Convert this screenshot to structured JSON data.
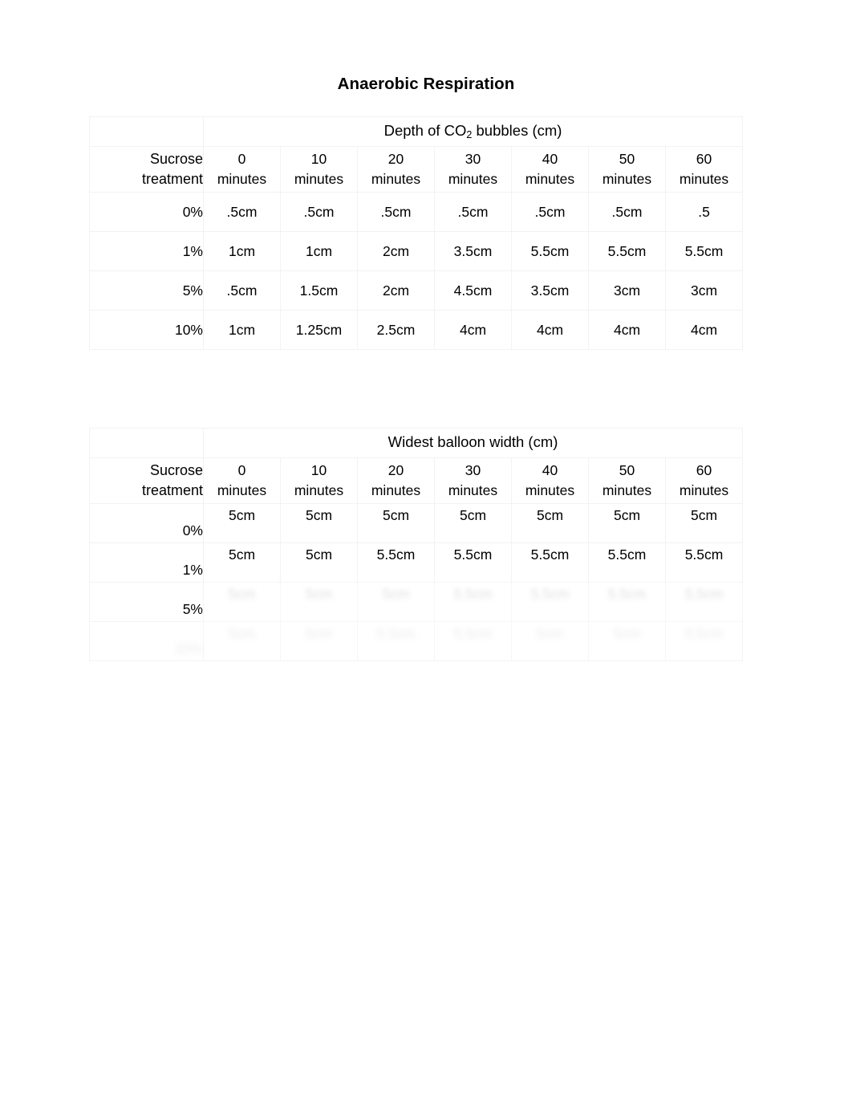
{
  "document": {
    "title": "Anaerobic Respiration"
  },
  "tables": [
    {
      "id": "table-1",
      "span_header": {
        "pre": "Depth of CO",
        "sub": "2",
        "post": " bubbles (cm)"
      },
      "corner_label": {
        "line1": "Sucrose",
        "line2": "treatment"
      },
      "column_headers": [
        {
          "number": "0",
          "unit": "minutes"
        },
        {
          "number": "10",
          "unit": "minutes"
        },
        {
          "number": "20",
          "unit": "minutes"
        },
        {
          "number": "30",
          "unit": "minutes"
        },
        {
          "number": "40",
          "unit": "minutes"
        },
        {
          "number": "50",
          "unit": "minutes"
        },
        {
          "number": "60",
          "unit": "minutes"
        }
      ],
      "rows": [
        {
          "label": "0%",
          "values": [
            ".5cm",
            ".5cm",
            ".5cm",
            ".5cm",
            ".5cm",
            ".5cm",
            ".5"
          ]
        },
        {
          "label": "1%",
          "values": [
            "1cm",
            "1cm",
            "2cm",
            "3.5cm",
            "5.5cm",
            "5.5cm",
            "5.5cm"
          ]
        },
        {
          "label": "5%",
          "values": [
            ".5cm",
            "1.5cm",
            "2cm",
            "4.5cm",
            "3.5cm",
            "3cm",
            "3cm"
          ]
        },
        {
          "label": "10%",
          "values": [
            "1cm",
            "1.25cm",
            "2.5cm",
            "4cm",
            "4cm",
            "4cm",
            "4cm"
          ]
        }
      ]
    },
    {
      "id": "table-2",
      "span_header": {
        "pre": "Widest balloon width (cm)",
        "sub": "",
        "post": ""
      },
      "corner_label": {
        "line1": "Sucrose",
        "line2": "treatment"
      },
      "column_headers": [
        {
          "number": "0",
          "unit": "minutes"
        },
        {
          "number": "10",
          "unit": "minutes"
        },
        {
          "number": "20",
          "unit": "minutes"
        },
        {
          "number": "30",
          "unit": "minutes"
        },
        {
          "number": "40",
          "unit": "minutes"
        },
        {
          "number": "50",
          "unit": "minutes"
        },
        {
          "number": "60",
          "unit": "minutes"
        }
      ],
      "rows": [
        {
          "label": "0%",
          "values": [
            "5cm",
            "5cm",
            "5cm",
            "5cm",
            "5cm",
            "5cm",
            "5cm"
          ]
        },
        {
          "label": "1%",
          "values": [
            "5cm",
            "5cm",
            "5.5cm",
            "5.5cm",
            "5.5cm",
            "5.5cm",
            "5.5cm"
          ]
        },
        {
          "label": "5%",
          "values": [
            "5cm",
            "5cm",
            "5cm",
            "5.5cm",
            "5.5cm",
            "5.5cm",
            "5.5cm"
          ]
        },
        {
          "label": "10%",
          "values": [
            "5cm",
            "5cm",
            "5.5cm",
            "5.5cm",
            "5cm",
            "5cm",
            "5.5cm"
          ]
        }
      ]
    }
  ]
}
